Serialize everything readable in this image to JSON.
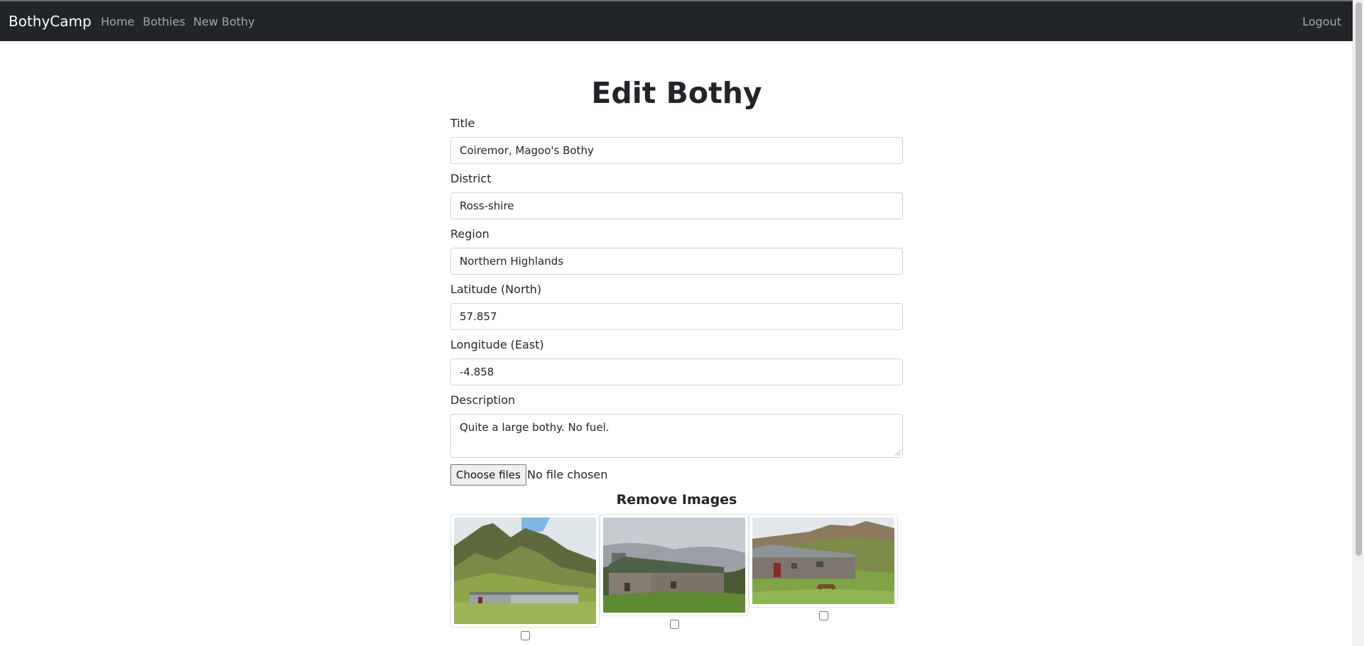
{
  "navbar": {
    "brand": "BothyCamp",
    "links": [
      {
        "label": "Home"
      },
      {
        "label": "Bothies"
      },
      {
        "label": "New Bothy"
      }
    ],
    "logout": "Logout"
  },
  "page": {
    "title": "Edit Bothy"
  },
  "form": {
    "title": {
      "label": "Title",
      "value": "Coiremor, Magoo's Bothy"
    },
    "district": {
      "label": "District",
      "value": "Ross-shire"
    },
    "region": {
      "label": "Region",
      "value": "Northern Highlands"
    },
    "latitude": {
      "label": "Latitude (North)",
      "value": "57.857"
    },
    "longitude": {
      "label": "Longitude (East)",
      "value": "-4.858"
    },
    "description": {
      "label": "Description",
      "value": "Quite a large bothy. No fuel."
    },
    "file": {
      "button": "Choose files",
      "status": "No file chosen"
    }
  },
  "remove_images": {
    "title": "Remove Images",
    "images": [
      {
        "name": "bothy-photo-1",
        "checked": false
      },
      {
        "name": "bothy-photo-2",
        "checked": false
      },
      {
        "name": "bothy-photo-3",
        "checked": false
      }
    ]
  },
  "colors": {
    "navbar_bg": "#212529",
    "nav_link": "#a6a8ab",
    "brand": "#ffffff",
    "border": "#ced4da"
  }
}
